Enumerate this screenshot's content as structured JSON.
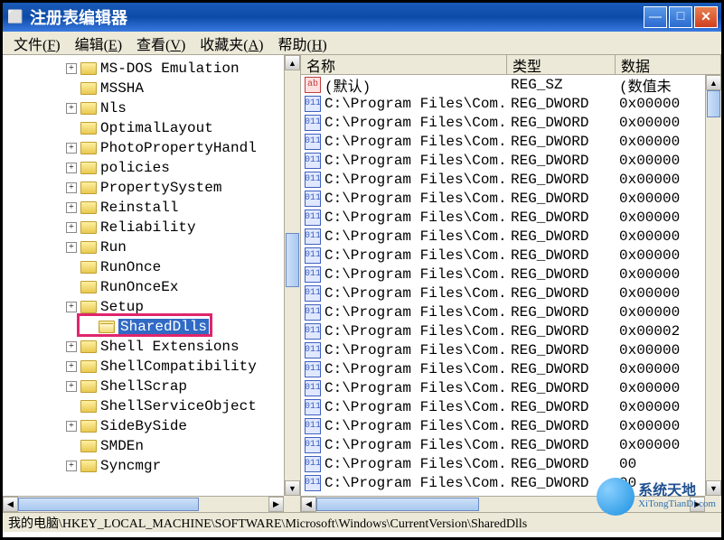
{
  "window": {
    "title": "注册表编辑器"
  },
  "menu": {
    "file": {
      "label": "文件",
      "accel": "F"
    },
    "edit": {
      "label": "编辑",
      "accel": "E"
    },
    "view": {
      "label": "查看",
      "accel": "V"
    },
    "favorites": {
      "label": "收藏夹",
      "accel": "A"
    },
    "help": {
      "label": "帮助",
      "accel": "H"
    }
  },
  "tree": {
    "items": [
      {
        "exp": "+",
        "label": "MS-DOS Emulation",
        "deep": false
      },
      {
        "exp": "",
        "label": "MSSHA",
        "deep": false
      },
      {
        "exp": "+",
        "label": "Nls",
        "deep": false
      },
      {
        "exp": "",
        "label": "OptimalLayout",
        "deep": false
      },
      {
        "exp": "+",
        "label": "PhotoPropertyHandl",
        "deep": false
      },
      {
        "exp": "+",
        "label": "policies",
        "deep": false
      },
      {
        "exp": "+",
        "label": "PropertySystem",
        "deep": false
      },
      {
        "exp": "+",
        "label": "Reinstall",
        "deep": false
      },
      {
        "exp": "+",
        "label": "Reliability",
        "deep": false
      },
      {
        "exp": "+",
        "label": "Run",
        "deep": false
      },
      {
        "exp": "",
        "label": "RunOnce",
        "deep": false
      },
      {
        "exp": "",
        "label": "RunOnceEx",
        "deep": false
      },
      {
        "exp": "+",
        "label": "Setup",
        "deep": false
      },
      {
        "exp": "",
        "label": "SharedDlls",
        "deep": true,
        "selected": true,
        "highlight": true
      },
      {
        "exp": "+",
        "label": "Shell Extensions",
        "deep": false
      },
      {
        "exp": "+",
        "label": "ShellCompatibility",
        "deep": false
      },
      {
        "exp": "+",
        "label": "ShellScrap",
        "deep": false
      },
      {
        "exp": "",
        "label": "ShellServiceObject",
        "deep": false
      },
      {
        "exp": "+",
        "label": "SideBySide",
        "deep": false
      },
      {
        "exp": "",
        "label": "SMDEn",
        "deep": false
      },
      {
        "exp": "+",
        "label": "Syncmgr",
        "deep": false
      }
    ]
  },
  "list": {
    "headers": {
      "name": "名称",
      "type": "类型",
      "data": "数据"
    },
    "rows": [
      {
        "icon": "str",
        "name": "(默认)",
        "type": "REG_SZ",
        "data": "(数值未"
      },
      {
        "icon": "dw",
        "name": "C:\\Program Files\\Com...",
        "type": "REG_DWORD",
        "data": "0x00000"
      },
      {
        "icon": "dw",
        "name": "C:\\Program Files\\Com...",
        "type": "REG_DWORD",
        "data": "0x00000"
      },
      {
        "icon": "dw",
        "name": "C:\\Program Files\\Com...",
        "type": "REG_DWORD",
        "data": "0x00000"
      },
      {
        "icon": "dw",
        "name": "C:\\Program Files\\Com...",
        "type": "REG_DWORD",
        "data": "0x00000"
      },
      {
        "icon": "dw",
        "name": "C:\\Program Files\\Com...",
        "type": "REG_DWORD",
        "data": "0x00000"
      },
      {
        "icon": "dw",
        "name": "C:\\Program Files\\Com...",
        "type": "REG_DWORD",
        "data": "0x00000"
      },
      {
        "icon": "dw",
        "name": "C:\\Program Files\\Com...",
        "type": "REG_DWORD",
        "data": "0x00000"
      },
      {
        "icon": "dw",
        "name": "C:\\Program Files\\Com...",
        "type": "REG_DWORD",
        "data": "0x00000"
      },
      {
        "icon": "dw",
        "name": "C:\\Program Files\\Com...",
        "type": "REG_DWORD",
        "data": "0x00000"
      },
      {
        "icon": "dw",
        "name": "C:\\Program Files\\Com...",
        "type": "REG_DWORD",
        "data": "0x00000"
      },
      {
        "icon": "dw",
        "name": "C:\\Program Files\\Com...",
        "type": "REG_DWORD",
        "data": "0x00000"
      },
      {
        "icon": "dw",
        "name": "C:\\Program Files\\Com...",
        "type": "REG_DWORD",
        "data": "0x00000"
      },
      {
        "icon": "dw",
        "name": "C:\\Program Files\\Com...",
        "type": "REG_DWORD",
        "data": "0x00002"
      },
      {
        "icon": "dw",
        "name": "C:\\Program Files\\Com...",
        "type": "REG_DWORD",
        "data": "0x00000"
      },
      {
        "icon": "dw",
        "name": "C:\\Program Files\\Com...",
        "type": "REG_DWORD",
        "data": "0x00000"
      },
      {
        "icon": "dw",
        "name": "C:\\Program Files\\Com...",
        "type": "REG_DWORD",
        "data": "0x00000"
      },
      {
        "icon": "dw",
        "name": "C:\\Program Files\\Com...",
        "type": "REG_DWORD",
        "data": "0x00000"
      },
      {
        "icon": "dw",
        "name": "C:\\Program Files\\Com...",
        "type": "REG_DWORD",
        "data": "0x00000"
      },
      {
        "icon": "dw",
        "name": "C:\\Program Files\\Com...",
        "type": "REG_DWORD",
        "data": "0x00000"
      },
      {
        "icon": "dw",
        "name": "C:\\Program Files\\Com...",
        "type": "REG_DWORD",
        "data": "00"
      },
      {
        "icon": "dw",
        "name": "C:\\Program Files\\Com...",
        "type": "REG_DWORD",
        "data": "00"
      }
    ]
  },
  "statusbar": "我的电脑\\HKEY_LOCAL_MACHINE\\SOFTWARE\\Microsoft\\Windows\\CurrentVersion\\SharedDlls",
  "watermark": {
    "text": "系统天地",
    "url": "XiTongTianDi.com"
  }
}
